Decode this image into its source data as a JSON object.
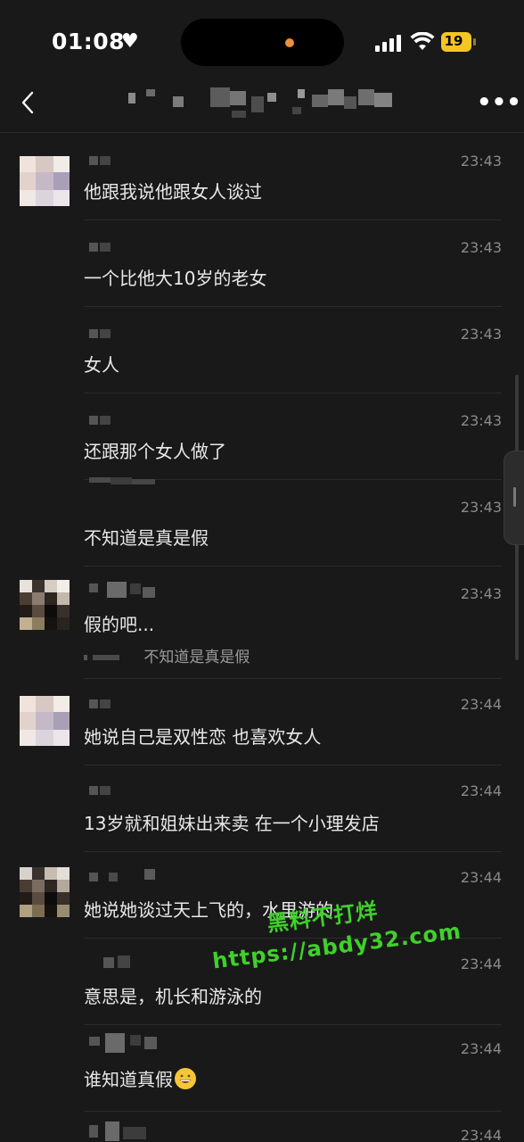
{
  "status_bar": {
    "time": "01:08",
    "battery": "19",
    "heart_icon": "heart-icon",
    "accent": "#f4c622"
  },
  "nav": {
    "back_icon": "chevron-left-icon",
    "more_icon": "more-icon",
    "more_label": "•••"
  },
  "messages": [
    {
      "time": "23:43",
      "text": "他跟我说他跟女人谈过",
      "avatar": "avatar-light"
    },
    {
      "time": "23:43",
      "text": "一个比他大10岁的老女"
    },
    {
      "time": "23:43",
      "text": "女人"
    },
    {
      "time": "23:43",
      "text": "还跟那个女人做了"
    },
    {
      "time": "23:43",
      "text": "不知道是真是假"
    },
    {
      "time": "23:43",
      "text": "假的吧...",
      "quote": "不知道是真是假",
      "avatar": "avatar-dark"
    },
    {
      "time": "23:44",
      "text": "她说自己是双性恋 也喜欢女人",
      "avatar": "avatar-light"
    },
    {
      "time": "23:44",
      "text": "13岁就和姐妹出来卖 在一个小理发店"
    },
    {
      "time": "23:44",
      "text": "她说她谈过天上飞的，水里游的",
      "avatar": "avatar-dark"
    },
    {
      "time": "23:44",
      "text": "意思是，机长和游泳的"
    },
    {
      "time": "23:44",
      "text": "谁知道真假"
    },
    {
      "time": "23:44",
      "text": ""
    }
  ],
  "watermark": {
    "line1": "黑料不打烊",
    "line2": "https://abdy32.com",
    "color": "#3fd12a"
  }
}
